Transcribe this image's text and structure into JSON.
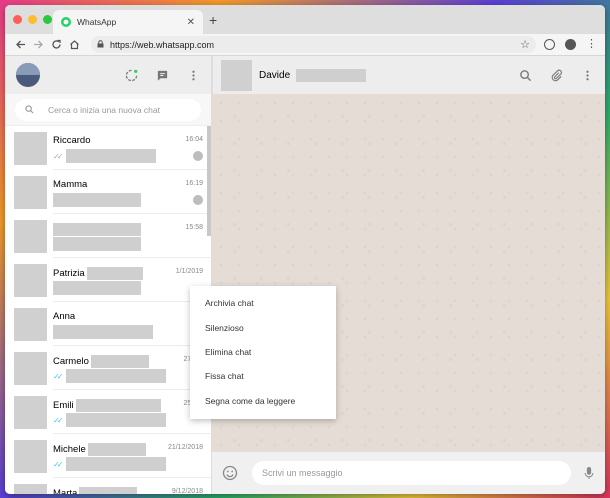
{
  "browser": {
    "tab_title": "WhatsApp",
    "tab_close": "✕",
    "new_tab": "+",
    "url": "https://web.whatsapp.com",
    "traffic_lights": [
      "#ff5f57",
      "#febc2e",
      "#28c840"
    ]
  },
  "sidebar": {
    "search_placeholder": "Cerca o inizia una nuova chat",
    "chats": [
      {
        "name": "Riccardo",
        "time": "16:04",
        "name_blur": 0,
        "preview_blur": 90,
        "ticks": "gray",
        "badge": "pin"
      },
      {
        "name": "Mamma",
        "time": "16:19",
        "name_blur": 0,
        "preview_blur": 88,
        "ticks": "none",
        "badge": "pin"
      },
      {
        "name": "",
        "time": "15:58",
        "name_blur": 88,
        "preview_blur": 88,
        "ticks": "none",
        "badge": "none"
      },
      {
        "name": "Patrizia",
        "time": "1/1/2019",
        "name_blur": 56,
        "preview_blur": 88,
        "ticks": "none",
        "badge": "chevron"
      },
      {
        "name": "Anna",
        "time": "",
        "name_blur": 0,
        "preview_blur": 100,
        "ticks": "none",
        "badge": "none"
      },
      {
        "name": "Carmelo",
        "time": "27/12/",
        "name_blur": 58,
        "preview_blur": 100,
        "ticks": "blue",
        "badge": "none"
      },
      {
        "name": "Emili",
        "time": "25/12/",
        "name_blur": 85,
        "preview_blur": 100,
        "ticks": "blue",
        "badge": "none"
      },
      {
        "name": "Michele",
        "time": "21/12/2018",
        "name_blur": 58,
        "preview_blur": 100,
        "ticks": "blue",
        "badge": "none"
      },
      {
        "name": "Marta",
        "time": "9/12/2018",
        "name_blur": 58,
        "preview_blur": 100,
        "ticks": "none",
        "badge": "none"
      }
    ]
  },
  "conversation": {
    "contact_name": "Davide",
    "message_placeholder": "Scrivi un messaggio"
  },
  "context_menu": {
    "items": [
      "Archivia chat",
      "Silenzioso",
      "Elimina chat",
      "Fissa chat",
      "Segna come da leggere"
    ]
  },
  "colors": {
    "accent": "#25d366",
    "tick_blue": "#4fc3f7",
    "wallpaper": "#e5ddd5"
  }
}
